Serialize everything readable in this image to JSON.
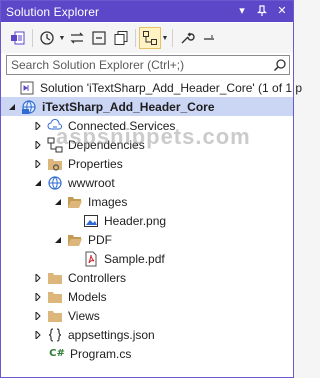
{
  "window": {
    "title": "Solution Explorer"
  },
  "search": {
    "placeholder": "Search Solution Explorer (Ctrl+;)"
  },
  "watermark": "aspsnippets.com",
  "tree": {
    "solution": "Solution 'iTextSharp_Add_Header_Core' (1 of 1 p",
    "project": "iTextSharp_Add_Header_Core",
    "connected_services": "Connected Services",
    "dependencies": "Dependencies",
    "properties": "Properties",
    "wwwroot": "wwwroot",
    "images": "Images",
    "header_png": "Header.png",
    "pdf": "PDF",
    "sample_pdf": "Sample.pdf",
    "controllers": "Controllers",
    "models": "Models",
    "views": "Views",
    "appsettings": "appsettings.json",
    "program": "Program.cs",
    "program_badge": "C#"
  },
  "colors": {
    "titlebar": "#5c47c9",
    "selection": "#cbd6f5",
    "folder": "#dcb67a"
  }
}
